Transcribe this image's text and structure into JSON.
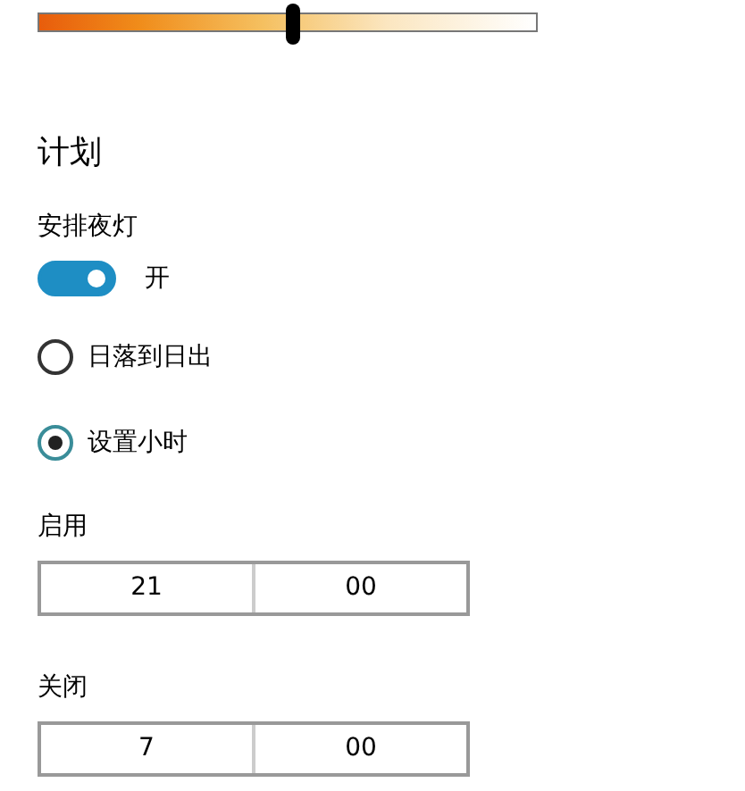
{
  "strength": {
    "level": 0.51
  },
  "schedule": {
    "title": "计划",
    "toggle_label": "安排夜灯",
    "toggle": {
      "on": true,
      "state_text": "开"
    },
    "options": [
      {
        "label": "日落到日出",
        "selected": false
      },
      {
        "label": "设置小时",
        "selected": true
      }
    ],
    "times": [
      {
        "label": "启用",
        "hour": "21",
        "minute": "00"
      },
      {
        "label": "关闭",
        "hour": "7",
        "minute": "00"
      }
    ]
  }
}
